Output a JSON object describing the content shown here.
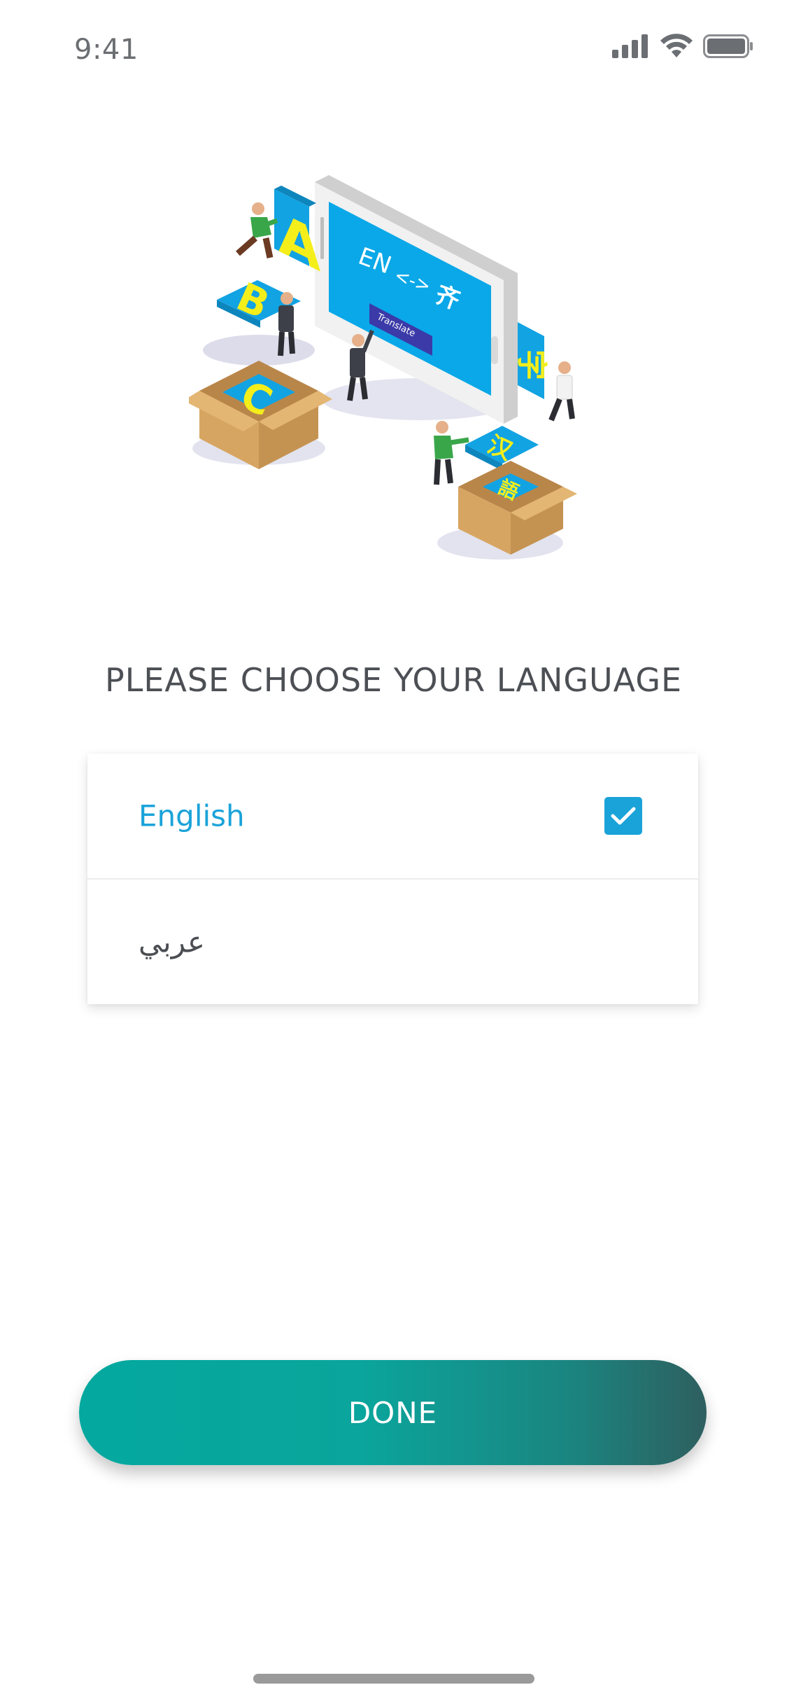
{
  "status_bar": {
    "time": "9:41",
    "icons": [
      "signal-icon",
      "wifi-icon",
      "battery-icon"
    ]
  },
  "illustration": {
    "name": "translation-illustration",
    "screen_text": "EN <-> 齐",
    "button_text": "Translate",
    "letters": [
      "A",
      "B",
      "C"
    ],
    "colors": {
      "phone_screen": "#0aa8e8",
      "letter_tile": "#12a3e3",
      "letter_fill": "#f4ee1a",
      "box": "#d7a562",
      "translate_button": "#3b3aa8"
    }
  },
  "heading": "PLEASE CHOOSE YOUR LANGUAGE",
  "languages": [
    {
      "label": "English",
      "selected": true
    },
    {
      "label": "عربي",
      "selected": false
    }
  ],
  "done_button": {
    "label": "DONE"
  },
  "colors": {
    "accent": "#1aa3d9",
    "button_gradient_start": "#04a89e",
    "button_gradient_end": "#2e5f5f"
  }
}
